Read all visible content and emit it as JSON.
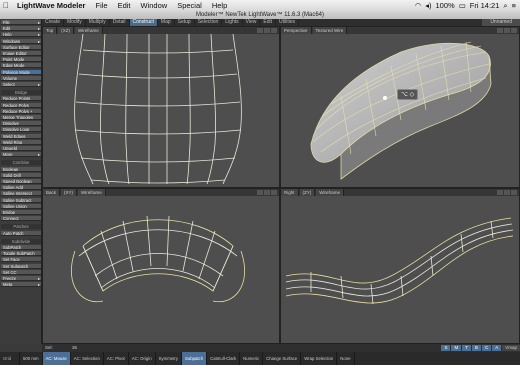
{
  "menubar": {
    "apple": "",
    "items": [
      "LightWave Modeler",
      "File",
      "Edit",
      "Window",
      "Special",
      "Help"
    ],
    "clock": "Fri 14:21",
    "battery": "100%"
  },
  "window_title": "Modeler™ NewTek LightWave™ 11.6.3 (Mac64)",
  "tabs": [
    "Create",
    "Modify",
    "Multiply",
    "Detail",
    "Construct",
    "Map",
    "Setup",
    "Selection",
    "Lights",
    "View",
    "Edit",
    "Utilities"
  ],
  "active_tab": "Construct",
  "tab_right": "Unnamed",
  "sidebar": {
    "items": [
      {
        "label": "File",
        "style": "drop"
      },
      {
        "label": "Edit",
        "style": "drop"
      },
      {
        "label": "Help",
        "style": "drop"
      },
      {
        "label": "Windows",
        "style": "drop"
      },
      {
        "label": "Surface Editor",
        "style": ""
      },
      {
        "label": "Image Editor",
        "style": ""
      },
      {
        "label": "Point Mode",
        "style": ""
      },
      {
        "label": "Edge Mode",
        "style": ""
      },
      {
        "label": "Polygon Mode",
        "style": "blue"
      },
      {
        "label": "Volume",
        "style": ""
      },
      {
        "label": "Select",
        "style": "drop"
      },
      {
        "label": "Bridge",
        "style": "head"
      },
      {
        "label": "Reduce Points",
        "style": ""
      },
      {
        "label": "Reduce Polys",
        "style": ""
      },
      {
        "label": "Reduce Polys +",
        "style": ""
      },
      {
        "label": "Merge Triangles",
        "style": ""
      },
      {
        "label": "Dissolve",
        "style": ""
      },
      {
        "label": "Dissolve Loop",
        "style": ""
      },
      {
        "label": "Weld Edges",
        "style": ""
      },
      {
        "label": "Weld Ring",
        "style": ""
      },
      {
        "label": "Unweld",
        "style": ""
      },
      {
        "label": "More",
        "style": "drop"
      },
      {
        "label": "Combine",
        "style": "head"
      },
      {
        "label": "Boolean",
        "style": ""
      },
      {
        "label": "Solid Drill",
        "style": ""
      },
      {
        "label": "Speed Boolean",
        "style": ""
      },
      {
        "label": "Spline Add",
        "style": ""
      },
      {
        "label": "Spline Intersect",
        "style": ""
      },
      {
        "label": "Spline Subtract",
        "style": ""
      },
      {
        "label": "Spline Union",
        "style": ""
      },
      {
        "label": "Bridge",
        "style": ""
      },
      {
        "label": "Connect",
        "style": ""
      },
      {
        "label": "Patches",
        "style": "head"
      },
      {
        "label": "Auto Patch",
        "style": ""
      },
      {
        "label": "Subdivide",
        "style": "head"
      },
      {
        "label": "SubPatch",
        "style": ""
      },
      {
        "label": "Toggle SubPatch",
        "style": ""
      },
      {
        "label": "Set Face",
        "style": ""
      },
      {
        "label": "Set Subpatch",
        "style": ""
      },
      {
        "label": "Set CC",
        "style": ""
      },
      {
        "label": "Freeze",
        "style": "drop"
      },
      {
        "label": "Meta",
        "style": "drop"
      }
    ]
  },
  "viewports": {
    "top_left": {
      "view": "Top",
      "axis": "(XZ)",
      "mode": "Wireframe"
    },
    "top_right": {
      "view": "Perspective",
      "mode": "Textured Wire"
    },
    "bottom_left": {
      "view": "Back",
      "axis": "(XY)",
      "mode": "Wireframe"
    },
    "bottom_right": {
      "view": "Right",
      "axis": "(ZY)",
      "mode": "Wireframe"
    }
  },
  "tooltip": "⌥ ◇",
  "statusbar": {
    "sel_label": "Sel:",
    "sel_value": "36",
    "right_items": [
      "S",
      "M",
      "T",
      "B",
      "C",
      "A",
      "Vmap"
    ]
  },
  "bottombar": {
    "grid_label": "Grid",
    "grid_value": "500 mm",
    "cells": [
      {
        "label": "AC: Mouse",
        "active": true
      },
      {
        "label": "AC: Selection",
        "active": false
      },
      {
        "label": "AC: Pivot",
        "active": false
      },
      {
        "label": "AC: Origin",
        "active": false
      },
      {
        "label": "Symmetry",
        "active": false
      },
      {
        "label": "Subpatch",
        "active": true
      },
      {
        "label": "Catmull-Clark",
        "active": false
      },
      {
        "label": "Numeric",
        "active": false
      },
      {
        "label": "Change Surface",
        "active": false
      },
      {
        "label": "Wrap Selection",
        "active": false
      },
      {
        "label": "None",
        "active": false
      }
    ]
  }
}
